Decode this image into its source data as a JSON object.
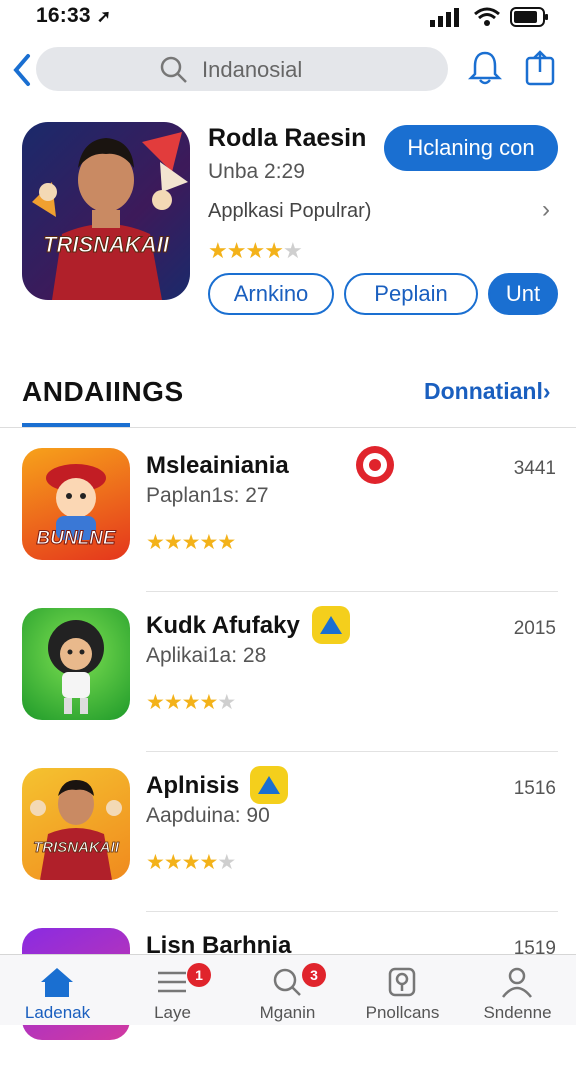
{
  "status": {
    "time": "16:33"
  },
  "search": {
    "text": "Indanosial"
  },
  "hero": {
    "title": "Rodla Raesin",
    "subtitle": "Unba 2:29",
    "category": "Applkasi Populrar)",
    "primary_button": "Hclaning con",
    "rating": 3.5,
    "image_text": "TRISNAKAII",
    "pills": [
      "Arnkino",
      "Peplain",
      "Unt"
    ]
  },
  "section": {
    "title": "ANDAIINGS",
    "link": "Donnatianl›"
  },
  "apps": [
    {
      "title": "Msleainiania",
      "subtitle": "Paplan1s: 27",
      "count": "3441",
      "rating": 5,
      "image_text": "BUNLNE",
      "badge": "red"
    },
    {
      "title": "Kudk Afufaky",
      "subtitle": "Aplikai1a: 28",
      "count": "2015",
      "rating": 4,
      "image_text": "",
      "badge": "yellow"
    },
    {
      "title": "Aplnisis",
      "subtitle": "Aapduina: 90",
      "count": "1516",
      "rating": 4,
      "image_text": "TRISNAKAII",
      "badge": "yellow"
    },
    {
      "title": "Lisn Barhnia",
      "subtitle": "",
      "count": "1519",
      "rating": 0,
      "image_text": "",
      "badge": ""
    }
  ],
  "tabs": [
    {
      "label": "Ladenak",
      "icon": "home-icon",
      "badge": ""
    },
    {
      "label": "Laye",
      "icon": "list-icon",
      "badge": "1"
    },
    {
      "label": "Mganin",
      "icon": "search-icon",
      "badge": "3"
    },
    {
      "label": "Pnollcans",
      "icon": "podcast-icon",
      "badge": ""
    },
    {
      "label": "Sndenne",
      "icon": "profile-icon",
      "badge": ""
    }
  ],
  "colors": {
    "accent": "#1a6fd1",
    "link": "#1a5fbf",
    "star": "#f3b21a",
    "badge": "#e0242c"
  }
}
